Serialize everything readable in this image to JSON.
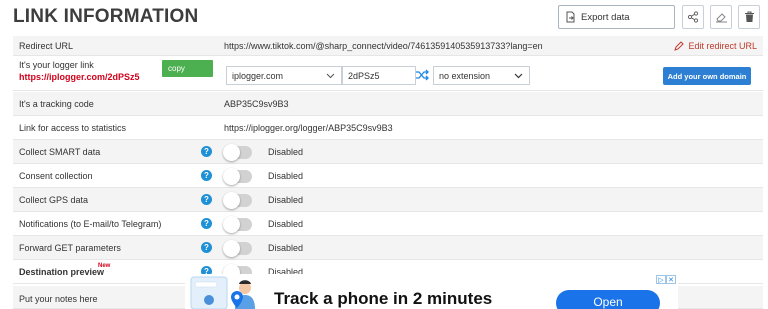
{
  "header": {
    "title": "LINK INFORMATION",
    "export_label": "Export data"
  },
  "rows": {
    "redirect": {
      "label": "Redirect URL",
      "value": "https://www.tiktok.com/@sharp_connect/video/7461359140535913733?lang=en",
      "edit_label": "Edit redirect URL"
    },
    "logger": {
      "label": "It's your logger link",
      "link": "https://iplogger.com/2dPSz5",
      "copy_label": "copy",
      "domain_selected": "iplogger.com",
      "code_value": "2dPSz5",
      "extension_selected": "no extension",
      "own_domain_label": "Add your own domain"
    },
    "tracking": {
      "label": "It's a tracking code",
      "value": "ABP35C9sv9B3"
    },
    "stats": {
      "label": "Link for access to statistics",
      "value": "https://iplogger.org/logger/ABP35C9sv9B3"
    },
    "smart": {
      "label": "Collect SMART data",
      "status": "Disabled"
    },
    "consent": {
      "label": "Consent collection",
      "status": "Disabled"
    },
    "gps": {
      "label": "Collect GPS data",
      "status": "Disabled"
    },
    "notify": {
      "label": "Notifications (to E-mail/to Telegram)",
      "status": "Disabled"
    },
    "forward": {
      "label": "Forward GET parameters",
      "status": "Disabled"
    },
    "dest": {
      "label": "Destination preview",
      "badge": "New",
      "status": "Disabled"
    },
    "notes": {
      "label": "Put your notes here"
    }
  },
  "ad": {
    "headline": "Track a phone in 2 minutes",
    "cta": "Open"
  },
  "colors": {
    "accent_blue": "#2d7fd3",
    "copy_green": "#4caf50",
    "link_red": "#d0021b",
    "help_blue": "#1e90d6"
  }
}
